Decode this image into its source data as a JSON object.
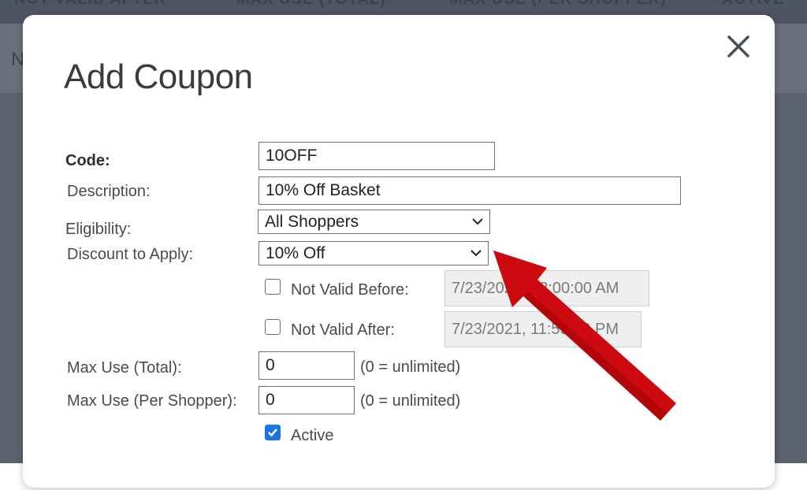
{
  "background": {
    "header_texts": [
      "NOT VALID AFTER",
      "MAX USE (TOTAL)",
      "MAX USE (PER SHOPPER)",
      "ACTIVE"
    ],
    "row_text": "N"
  },
  "modal": {
    "title": "Add Coupon",
    "close_icon": "close-icon",
    "fields": {
      "code_label": "Code:",
      "code_value": "10OFF",
      "description_label": "Description:",
      "description_value": "10% Off Basket",
      "eligibility_label": "Eligibility:",
      "eligibility_value": "All Shoppers",
      "discount_label": "Discount to Apply:",
      "discount_value": "10% Off",
      "not_valid_before_label": "Not Valid Before:",
      "not_valid_before_value": "7/23/2021, 12:00:00 AM",
      "not_valid_before_checked": false,
      "not_valid_after_label": "Not Valid After:",
      "not_valid_after_value": "7/23/2021, 11:59:59 PM",
      "not_valid_after_checked": false,
      "max_use_total_label": "Max Use (Total):",
      "max_use_total_value": "0",
      "max_use_total_hint": "(0 = unlimited)",
      "max_use_shopper_label": "Max Use (Per Shopper):",
      "max_use_shopper_value": "0",
      "max_use_shopper_hint": "(0 = unlimited)",
      "active_label": "Active",
      "active_checked": true
    }
  },
  "colors": {
    "backdrop": "#5d626f",
    "arrow": "#c8090b",
    "checkbox_checked": "#1a73e8"
  }
}
